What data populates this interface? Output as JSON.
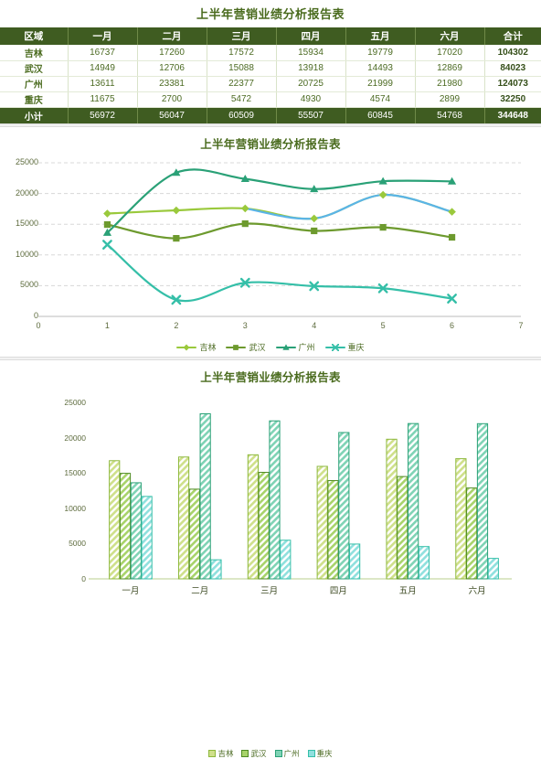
{
  "table": {
    "title": "上半年营销业绩分析报告表",
    "columns": [
      "区域",
      "一月",
      "二月",
      "三月",
      "四月",
      "五月",
      "六月",
      "合计"
    ],
    "rows": [
      {
        "region": "吉林",
        "values": [
          16737,
          17260,
          17572,
          15934,
          19779,
          17020
        ],
        "total": 104302
      },
      {
        "region": "武汉",
        "values": [
          14949,
          12706,
          15088,
          13918,
          14493,
          12869
        ],
        "total": 84023
      },
      {
        "region": "广州",
        "values": [
          13611,
          23381,
          22377,
          20725,
          21999,
          21980
        ],
        "total": 124073
      },
      {
        "region": "重庆",
        "values": [
          11675,
          2700,
          5472,
          4930,
          4574,
          2899
        ],
        "total": 32250
      }
    ],
    "subtotal": {
      "label": "小计",
      "values": [
        56972,
        56047,
        60509,
        55507,
        60845,
        54768
      ],
      "total": 344648
    },
    "header_bg": "#3f5c21",
    "title_color": "#4a6b1e"
  },
  "chart_data": [
    {
      "type": "line",
      "title": "上半年营销业绩分析报告表",
      "xlabel": "",
      "ylabel": "",
      "x": [
        1,
        2,
        3,
        4,
        5,
        6
      ],
      "xtick_labels": [
        "0",
        "1",
        "2",
        "3",
        "4",
        "5",
        "6",
        "7"
      ],
      "xlim": [
        0,
        7
      ],
      "ylim": [
        0,
        25000
      ],
      "ytick_labels": [
        "0",
        "5000",
        "10000",
        "15000",
        "20000",
        "25000"
      ],
      "grid": true,
      "legend_position": "bottom",
      "series": [
        {
          "name": "吉林",
          "values": [
            16737,
            17260,
            17572,
            15934,
            19779,
            17020
          ],
          "color": "#9ac93c",
          "marker": "diamond"
        },
        {
          "name": "武汉",
          "values": [
            14949,
            12706,
            15088,
            13918,
            14493,
            12869
          ],
          "color": "#6d9a2e",
          "marker": "square"
        },
        {
          "name": "广州",
          "values": [
            13611,
            23381,
            22377,
            20725,
            21999,
            21980
          ],
          "color": "#2aa177",
          "marker": "triangle"
        },
        {
          "name": "重庆",
          "values": [
            11675,
            2700,
            5472,
            4930,
            4574,
            2899
          ],
          "color": "#35bfa8",
          "marker": "cross"
        }
      ]
    },
    {
      "type": "bar",
      "title": "上半年营销业绩分析报告表",
      "xlabel": "",
      "ylabel": "",
      "categories": [
        "一月",
        "二月",
        "三月",
        "四月",
        "五月",
        "六月"
      ],
      "ylim": [
        0,
        25000
      ],
      "ytick_labels": [
        "0",
        "5000",
        "10000",
        "15000",
        "20000",
        "25000"
      ],
      "grid": false,
      "legend_position": "top",
      "series": [
        {
          "name": "吉林",
          "values": [
            16737,
            17260,
            17572,
            15934,
            19779,
            17020
          ],
          "color": "#cfe08a",
          "edge": "#8db83c"
        },
        {
          "name": "武汉",
          "values": [
            14949,
            12706,
            15088,
            13918,
            14493,
            12869
          ],
          "color": "#a8d36a",
          "edge": "#4f8a23"
        },
        {
          "name": "广州",
          "values": [
            13611,
            23381,
            22377,
            20725,
            21999,
            21980
          ],
          "color": "#7fd3b5",
          "edge": "#2aa177"
        },
        {
          "name": "重庆",
          "values": [
            11675,
            2700,
            5472,
            4930,
            4574,
            2899
          ],
          "color": "#8fe0de",
          "edge": "#35bfa8"
        }
      ]
    }
  ]
}
